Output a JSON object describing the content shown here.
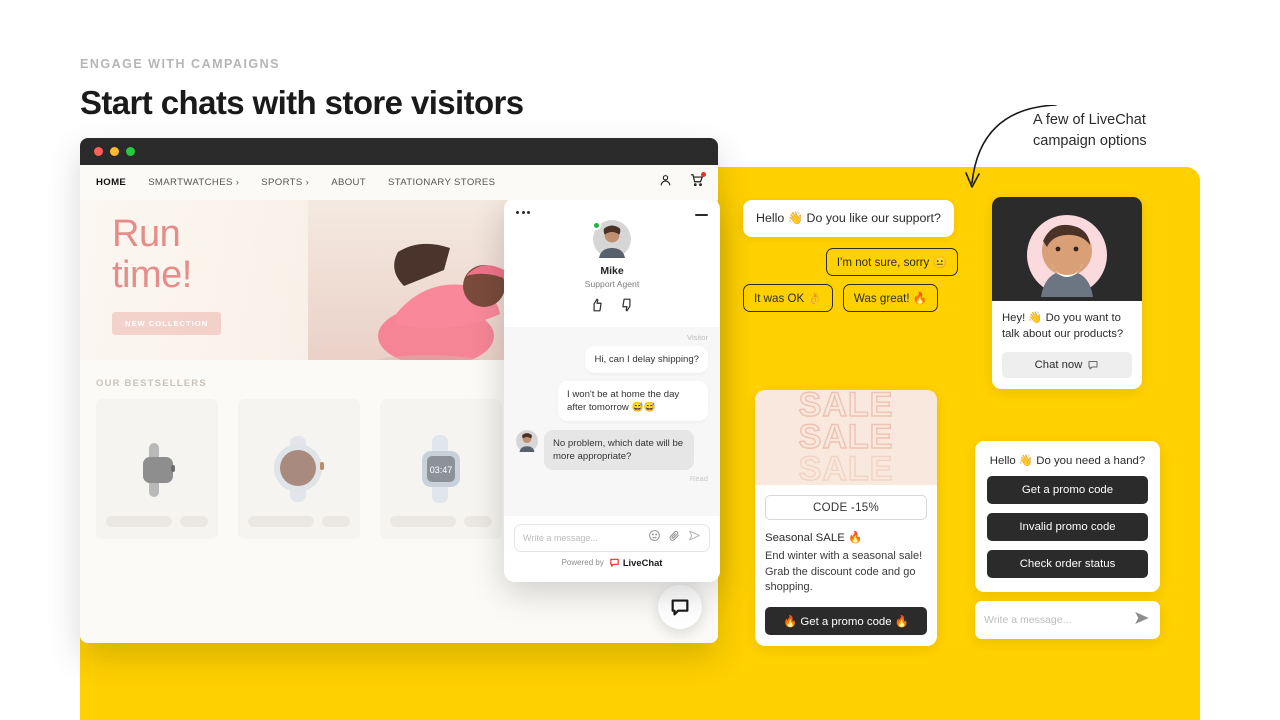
{
  "header": {
    "eyebrow": "ENGAGE WITH CAMPAIGNS",
    "headline": "Start chats with store visitors"
  },
  "annotation": {
    "line1": "A few of LiveChat",
    "line2": "campaign options"
  },
  "browser": {
    "nav": [
      {
        "label": "HOME",
        "active": true
      },
      {
        "label": "SMARTWATCHES ›",
        "active": false
      },
      {
        "label": "SPORTS ›",
        "active": false
      },
      {
        "label": "ABOUT",
        "active": false
      },
      {
        "label": "STATIONARY STORES",
        "active": false
      }
    ],
    "account_icon": "user-icon",
    "cart_icon": "cart-icon",
    "hero": {
      "title_line1": "Run",
      "title_line2": "time!",
      "badge": "NEW COLLECTION"
    },
    "bestsellers": {
      "title": "OUR BESTSELLERS",
      "watch_time": "03:47"
    },
    "launcher_icon": "chat-bubble-icon"
  },
  "chat_window": {
    "menu_icon": "more-options-icon",
    "minimize_icon": "minimize-icon",
    "agent": {
      "name": "Mike",
      "role": "Support Agent",
      "status": "online",
      "thumbs_up_icon": "thumbs-up-icon",
      "thumbs_down_icon": "thumbs-down-icon"
    },
    "visitor_label": "Visitor",
    "messages": [
      {
        "from": "visitor",
        "text": "Hi, can I delay shipping?"
      },
      {
        "from": "visitor",
        "text": "I won't be at home the day after tomorrow 😅😅"
      },
      {
        "from": "agent",
        "text": "No problem, which date will be more appropriate?"
      }
    ],
    "read_status": "Read",
    "input_placeholder": "Write a message...",
    "emoji_icon": "emoji-icon",
    "attach_icon": "paperclip-icon",
    "send_icon": "send-icon",
    "powered_by": "Powered by",
    "brand": "LiveChat"
  },
  "campaigns": {
    "greeting_bubble": "Hello 👋 Do you like our support?",
    "quick_replies": [
      "I'm not sure, sorry 😐",
      "It was OK 👌",
      "Was great! 🔥"
    ],
    "promo_card": {
      "sale_word": "SALE",
      "code": "CODE -15%",
      "heading": "Seasonal SALE 🔥",
      "body": "End winter with a seasonal sale! Grab the discount code and go shopping.",
      "button": "🔥 Get a promo code 🔥"
    },
    "agent_card": {
      "text": "Hey! 👋 Do you want to talk about our products?",
      "button": "Chat now",
      "button_icon": "chat-bubble-icon"
    },
    "options_card": {
      "greeting": "Hello 👋 Do you need a hand?",
      "options": [
        "Get a promo code",
        "Invalid promo code",
        "Check order status"
      ]
    },
    "message_bar": {
      "placeholder": "Write a message...",
      "send_icon": "send-icon"
    }
  },
  "colors": {
    "brand_yellow": "#ffd100",
    "dark": "#2b2b2b",
    "accent_red": "#e8302a"
  }
}
